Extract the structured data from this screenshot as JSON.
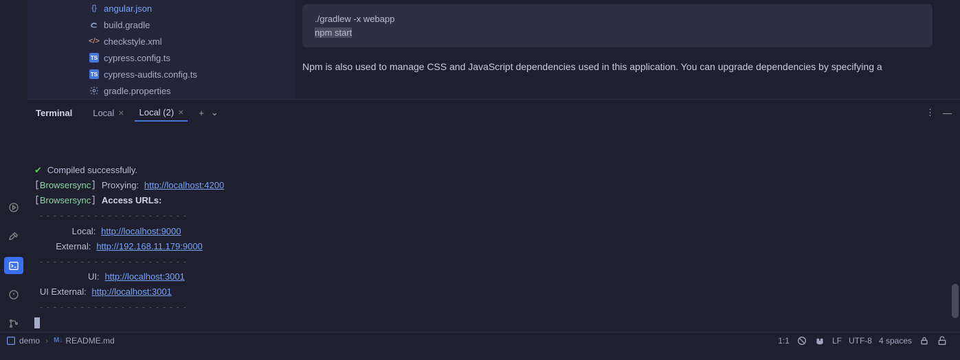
{
  "sidebar": {
    "files": [
      {
        "name": "angular.json",
        "icon": "curly",
        "selected": true
      },
      {
        "name": "build.gradle",
        "icon": "elephant"
      },
      {
        "name": "checkstyle.xml",
        "icon": "tag"
      },
      {
        "name": "cypress.config.ts",
        "icon": "ts"
      },
      {
        "name": "cypress-audits.config.ts",
        "icon": "ts"
      },
      {
        "name": "gradle.properties",
        "icon": "gear"
      }
    ]
  },
  "editor": {
    "code_line1": "./gradlew -x webapp",
    "code_line2": "npm start",
    "prose": "Npm is also used to manage CSS and JavaScript dependencies used in this application. You can upgrade dependencies by specifying a"
  },
  "terminal": {
    "title": "Terminal",
    "tabs": [
      {
        "label": "Local",
        "active": false
      },
      {
        "label": "Local (2)",
        "active": true
      }
    ],
    "output": {
      "compiled": "Compiled successfully.",
      "bsync": "Browsersync",
      "proxy_label": "Proxying:",
      "proxy_url": "http://localhost:4200",
      "access_label": "Access URLs:",
      "local_label": "Local:",
      "local_url": "http://localhost:9000",
      "external_label": "External:",
      "external_url": "http://192.168.11.179:9000",
      "ui_label": "UI:",
      "ui_url": "http://localhost:3001",
      "ui_ext_label": "UI External:",
      "ui_ext_url": "http://localhost:3001"
    }
  },
  "statusbar": {
    "project": "demo",
    "file_icon": "M↓",
    "file": "README.md",
    "cursor": "1:1",
    "lineEnding": "LF",
    "encoding": "UTF-8",
    "indent": "4 spaces"
  }
}
